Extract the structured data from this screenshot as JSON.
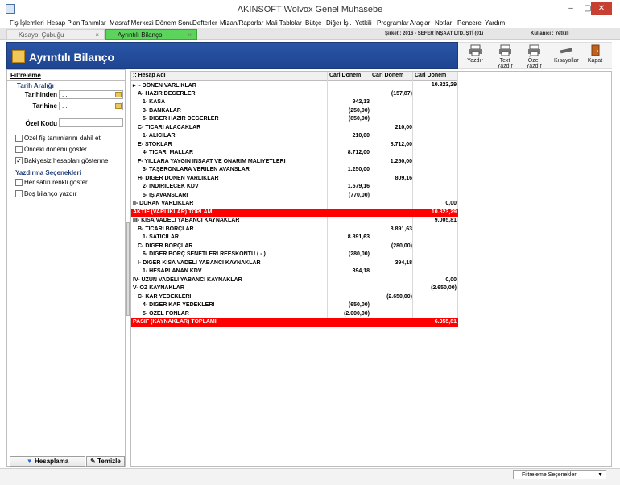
{
  "window": {
    "title": "AKINSOFT Wolvox Genel Muhasebe",
    "minimize": "–",
    "maximize": "▢",
    "close": "✕"
  },
  "menu": [
    "Fiş İşlemleri",
    "Hesap Planı",
    "Tanımlar",
    "Masraf Merkezi",
    "Dönem Sonu",
    "Defterler",
    "Mizan/Raporlar",
    "Mali Tablolar",
    "Bütçe",
    "Diğer İşl.",
    "Yetkili",
    "Programlar",
    "Araçlar",
    "Notlar",
    "Pencere",
    "Yardım"
  ],
  "tabs": [
    {
      "label": "Kısayol Çubuğu",
      "close": "×"
    },
    {
      "label": "Ayrıntılı Bilanço",
      "close": "×"
    }
  ],
  "company": "Şirket : 2016 - SEFER İNŞAAT LTD. ŞTİ (01)",
  "user": "Kullanıcı : Yetkili",
  "header": {
    "title": "Ayrıntılı Bilanço"
  },
  "toolbar": [
    "Yazdır",
    "Text Yazdır",
    "Özel Yazdır",
    "Kısayollar",
    "Kapat"
  ],
  "filter": {
    "tab": "Filtreleme",
    "date_range": "Tarih Aralığı",
    "from_label": "Tarihinden",
    "from_value": ". .",
    "to_label": "Tarihine",
    "to_value": ". .",
    "special_code": "Özel Kodu",
    "checks": [
      {
        "label": "Özel fiş tanımlarını dahil et",
        "checked": false
      },
      {
        "label": "Önceki dönemi göster",
        "checked": false
      },
      {
        "label": "Bakiyesiz hesapları gösterme",
        "checked": true
      }
    ],
    "print_options": "Yazdırma Seçenekleri",
    "print_checks": [
      {
        "label": "Her satırı renkli göster",
        "checked": false
      },
      {
        "label": "Boş bilanço yazdır",
        "checked": false
      }
    ],
    "calc_button": "Hesaplama",
    "clear_button": "Temizle"
  },
  "grid": {
    "headers": [
      ":: Hesap Adı",
      "Cari Dönem",
      "Cari Dönem",
      "Cari Dönem"
    ],
    "rows": [
      {
        "name": "▸ I-  DÖNEN VARLIKLAR",
        "indent": 0,
        "c1": "",
        "c2": "",
        "c3": "10.823,29"
      },
      {
        "name": "A- HAZIR DEĞERLER",
        "indent": 1,
        "c1": "",
        "c2": "(157,87)",
        "c3": ""
      },
      {
        "name": "1- KASA",
        "indent": 2,
        "c1": "942,13",
        "c2": "",
        "c3": ""
      },
      {
        "name": "3- BANKALAR",
        "indent": 2,
        "c1": "(250,00)",
        "c2": "",
        "c3": ""
      },
      {
        "name": "5- DİĞER HAZIR DEĞERLER",
        "indent": 2,
        "c1": "(850,00)",
        "c2": "",
        "c3": ""
      },
      {
        "name": "C- TİCARİ ALACAKLAR",
        "indent": 1,
        "c1": "",
        "c2": "210,00",
        "c3": ""
      },
      {
        "name": "1- ALICILAR",
        "indent": 2,
        "c1": "210,00",
        "c2": "",
        "c3": ""
      },
      {
        "name": "E- STOKLAR",
        "indent": 1,
        "c1": "",
        "c2": "8.712,00",
        "c3": ""
      },
      {
        "name": "4- TİCARİ MALLAR",
        "indent": 2,
        "c1": "8.712,00",
        "c2": "",
        "c3": ""
      },
      {
        "name": "F- YILLARA YAYGIN İNŞAAT VE ONARIM MALİYETLERİ",
        "indent": 1,
        "c1": "",
        "c2": "1.250,00",
        "c3": ""
      },
      {
        "name": "3- TAŞERONLARA VERİLEN AVANSLAR",
        "indent": 2,
        "c1": "1.250,00",
        "c2": "",
        "c3": ""
      },
      {
        "name": "H- DİĞER DÖNEN VARLIKLAR",
        "indent": 1,
        "c1": "",
        "c2": "809,16",
        "c3": ""
      },
      {
        "name": "2- İNDİRİLECEK KDV",
        "indent": 2,
        "c1": "1.579,16",
        "c2": "",
        "c3": ""
      },
      {
        "name": "5- İŞ AVANSLARI",
        "indent": 2,
        "c1": "(770,00)",
        "c2": "",
        "c3": ""
      },
      {
        "name": "II-  DURAN VARLIKLAR",
        "indent": 0,
        "c1": "",
        "c2": "",
        "c3": "0,00"
      },
      {
        "name": "AKTİF (VARLIKLAR) TOPLAMI",
        "indent": 0,
        "c1": "",
        "c2": "",
        "c3": "10.823,29",
        "red": true
      },
      {
        "name": "III-  KISA VADELİ YABANCI KAYNAKLAR",
        "indent": 0,
        "c1": "",
        "c2": "",
        "c3": "9.005,81"
      },
      {
        "name": "B- TİCARİ BORÇLAR",
        "indent": 1,
        "c1": "",
        "c2": "8.891,63",
        "c3": ""
      },
      {
        "name": "1- SATICILAR",
        "indent": 2,
        "c1": "8.891,63",
        "c2": "",
        "c3": ""
      },
      {
        "name": "C- DİĞER BORÇLAR",
        "indent": 1,
        "c1": "",
        "c2": "(280,00)",
        "c3": ""
      },
      {
        "name": "6- DİĞER BORÇ SENETLERİ REESKONTU ( - )",
        "indent": 2,
        "c1": "(280,00)",
        "c2": "",
        "c3": ""
      },
      {
        "name": "I- DİĞER KISA VADELİ YABANCI KAYNAKLAR",
        "indent": 1,
        "c1": "",
        "c2": "394,18",
        "c3": ""
      },
      {
        "name": "1- HESAPLANAN KDV",
        "indent": 2,
        "c1": "394,18",
        "c2": "",
        "c3": ""
      },
      {
        "name": "IV-  UZUN VADELİ YABANCI KAYNAKLAR",
        "indent": 0,
        "c1": "",
        "c2": "",
        "c3": "0,00"
      },
      {
        "name": "V-  ÖZ KAYNAKLAR",
        "indent": 0,
        "c1": "",
        "c2": "",
        "c3": "(2.650,00)"
      },
      {
        "name": "C- KAR YEDEKLERİ",
        "indent": 1,
        "c1": "",
        "c2": "(2.650,00)",
        "c3": ""
      },
      {
        "name": "4- DİĞER KAR YEDEKLERİ",
        "indent": 2,
        "c1": "(650,00)",
        "c2": "",
        "c3": ""
      },
      {
        "name": "5- ÖZEL FONLAR",
        "indent": 2,
        "c1": "(2.000,00)",
        "c2": "",
        "c3": ""
      },
      {
        "name": "PASİF (KAYNAKLAR) TOPLAMI",
        "indent": 0,
        "c1": "",
        "c2": "",
        "c3": "6.355,81",
        "red": true
      }
    ]
  },
  "status": {
    "filter_options": "Filtreleme Seçenekleri",
    "arrow": "▼"
  },
  "colors": {
    "header_blue": "#2a55a6",
    "active_tab": "#5cd45c",
    "total_row": "#ff0000"
  }
}
